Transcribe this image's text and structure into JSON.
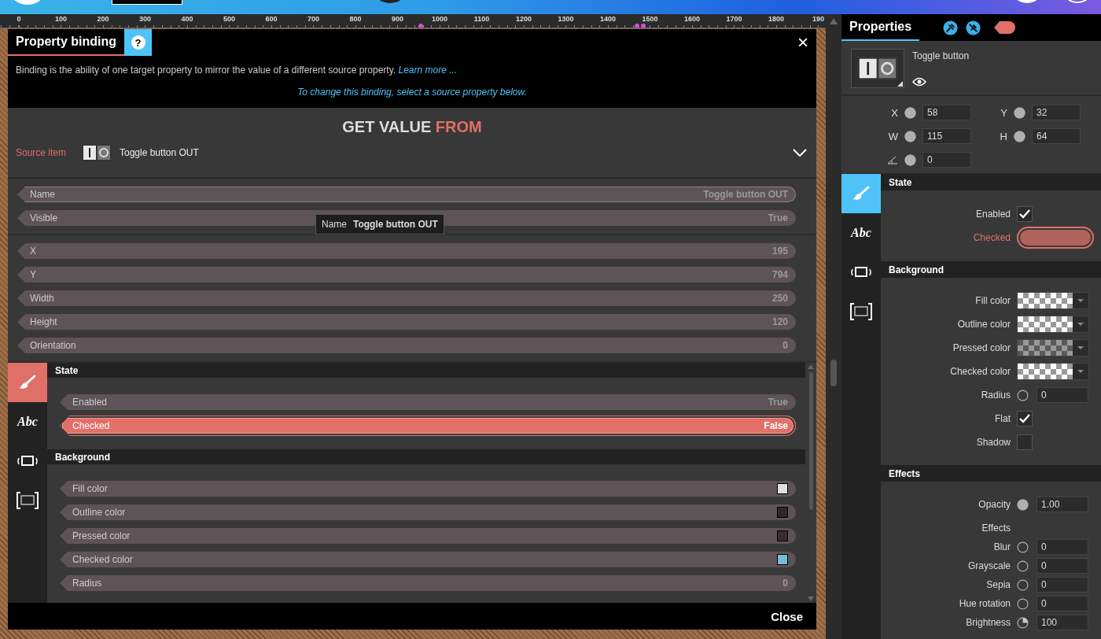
{
  "ruler": {
    "labels": [
      "0",
      "100",
      "200",
      "300",
      "400",
      "500",
      "600",
      "700",
      "800",
      "900",
      "1000",
      "1100",
      "1200",
      "1300",
      "1400",
      "1500",
      "1600",
      "1700",
      "1800",
      "190"
    ]
  },
  "dialog": {
    "title": "Property binding",
    "help": "?",
    "close_icon": "×",
    "description": "Binding is the ability of one target property to mirror the value of a different source property.",
    "learn_more": "Learn more ...",
    "hint": "To change this binding, select a source property below.",
    "heading": "GET VALUE",
    "heading_accent": "FROM",
    "source_label": "Source item",
    "source_name": "Toggle button OUT",
    "property_groups": [
      {
        "rows": [
          {
            "label": "Name",
            "kind": "text",
            "value": "Toggle button OUT",
            "selected": false,
            "hovered": true
          },
          {
            "label": "Visible",
            "kind": "text",
            "value": "True",
            "selected": false,
            "hovered": false
          }
        ]
      },
      {
        "rows": [
          {
            "label": "X",
            "kind": "text",
            "value": "195",
            "selected": false,
            "hovered": false
          },
          {
            "label": "Y",
            "kind": "text",
            "value": "794",
            "selected": false,
            "hovered": false
          },
          {
            "label": "Width",
            "kind": "text",
            "value": "250",
            "selected": false,
            "hovered": false
          },
          {
            "label": "Height",
            "kind": "text",
            "value": "120",
            "selected": false,
            "hovered": false
          },
          {
            "label": "Orientation",
            "kind": "text",
            "value": "0",
            "selected": false,
            "hovered": false
          }
        ]
      }
    ],
    "tooltip": {
      "label": "Name",
      "value": "Toggle button OUT"
    },
    "side_tabs": [
      {
        "kind": "brush",
        "selected": true
      },
      {
        "kind": "text",
        "label": "Abc",
        "selected": false
      },
      {
        "kind": "wave-rect",
        "selected": false
      },
      {
        "kind": "bracket-rect",
        "selected": false
      }
    ],
    "sections": [
      {
        "title": "State",
        "rows": [
          {
            "label": "Enabled",
            "kind": "text",
            "value": "True",
            "selected": false,
            "hovered": false
          },
          {
            "label": "Checked",
            "kind": "text",
            "value": "False",
            "selected": true,
            "hovered": false
          }
        ]
      },
      {
        "title": "Background",
        "rows": [
          {
            "label": "Fill color",
            "kind": "swatch",
            "color": "#e0e0e0",
            "selected": false,
            "hovered": false
          },
          {
            "label": "Outline color",
            "kind": "swatch",
            "color": "#2a2a2a",
            "selected": false,
            "hovered": false
          },
          {
            "label": "Pressed color",
            "kind": "swatch",
            "color": "#342e2f",
            "selected": false,
            "hovered": false
          },
          {
            "label": "Checked color",
            "kind": "swatch",
            "color": "#78bcda",
            "selected": false,
            "hovered": false
          },
          {
            "label": "Radius",
            "kind": "text",
            "value": "0",
            "selected": false,
            "hovered": false
          }
        ]
      }
    ],
    "close": "Close"
  },
  "properties": {
    "title": "Properties",
    "item_name": "Toggle button",
    "geometry": [
      [
        {
          "kind": "text",
          "label": "X",
          "value": "58",
          "filled": true
        },
        {
          "kind": "text",
          "label": "Y",
          "value": "32",
          "filled": true
        }
      ],
      [
        {
          "kind": "text",
          "label": "W",
          "value": "115",
          "filled": true
        },
        {
          "kind": "text",
          "label": "H",
          "value": "64",
          "filled": true
        }
      ],
      [
        {
          "kind": "angle",
          "value": "0",
          "filled": true
        }
      ]
    ],
    "side_tabs": [
      {
        "kind": "brush",
        "selected": true
      },
      {
        "kind": "text",
        "label": "Abc",
        "selected": false
      },
      {
        "kind": "wave-rect",
        "selected": false
      },
      {
        "kind": "bracket-rect",
        "selected": false
      }
    ],
    "sections": [
      {
        "title": "State",
        "rows": [
          {
            "kind": "checkbox",
            "label": "Enabled",
            "checked": true,
            "bound": false
          },
          {
            "kind": "toggle",
            "label": "Checked",
            "checked": false,
            "bound": true
          }
        ]
      },
      {
        "title": "Background",
        "rows": [
          {
            "kind": "color",
            "label": "Fill color",
            "color": "#ffffff",
            "bound": false
          },
          {
            "kind": "color",
            "label": "Outline color",
            "color": "#ffffff",
            "bound": false
          },
          {
            "kind": "color",
            "label": "Pressed color",
            "color": "#5a5a5a",
            "bound": false
          },
          {
            "kind": "color",
            "label": "Checked color",
            "color": "#ffffff",
            "bound": false
          },
          {
            "kind": "number",
            "label": "Radius",
            "value": "0",
            "filled": false,
            "bound": false
          },
          {
            "kind": "checkbox",
            "label": "Flat",
            "checked": true,
            "bound": false
          },
          {
            "kind": "checkbox",
            "label": "Shadow",
            "checked": false,
            "bound": false
          }
        ]
      },
      {
        "title": "Effects",
        "rows": [
          {
            "kind": "number",
            "label": "Opacity",
            "value": "1.00",
            "filled": true,
            "bound": false
          },
          {
            "kind": "label",
            "label": "Effects",
            "bound": false
          },
          {
            "kind": "number",
            "label": "Blur",
            "value": "0",
            "filled": false,
            "bound": false
          },
          {
            "kind": "number",
            "label": "Grayscale",
            "value": "0",
            "filled": false,
            "bound": false
          },
          {
            "kind": "number",
            "label": "Sepia",
            "value": "0",
            "filled": false,
            "bound": false
          },
          {
            "kind": "number",
            "label": "Hue rotation",
            "value": "0",
            "filled": false,
            "bound": false
          },
          {
            "kind": "dial",
            "label": "Brightness",
            "value": "100",
            "bound": false
          }
        ]
      }
    ]
  }
}
